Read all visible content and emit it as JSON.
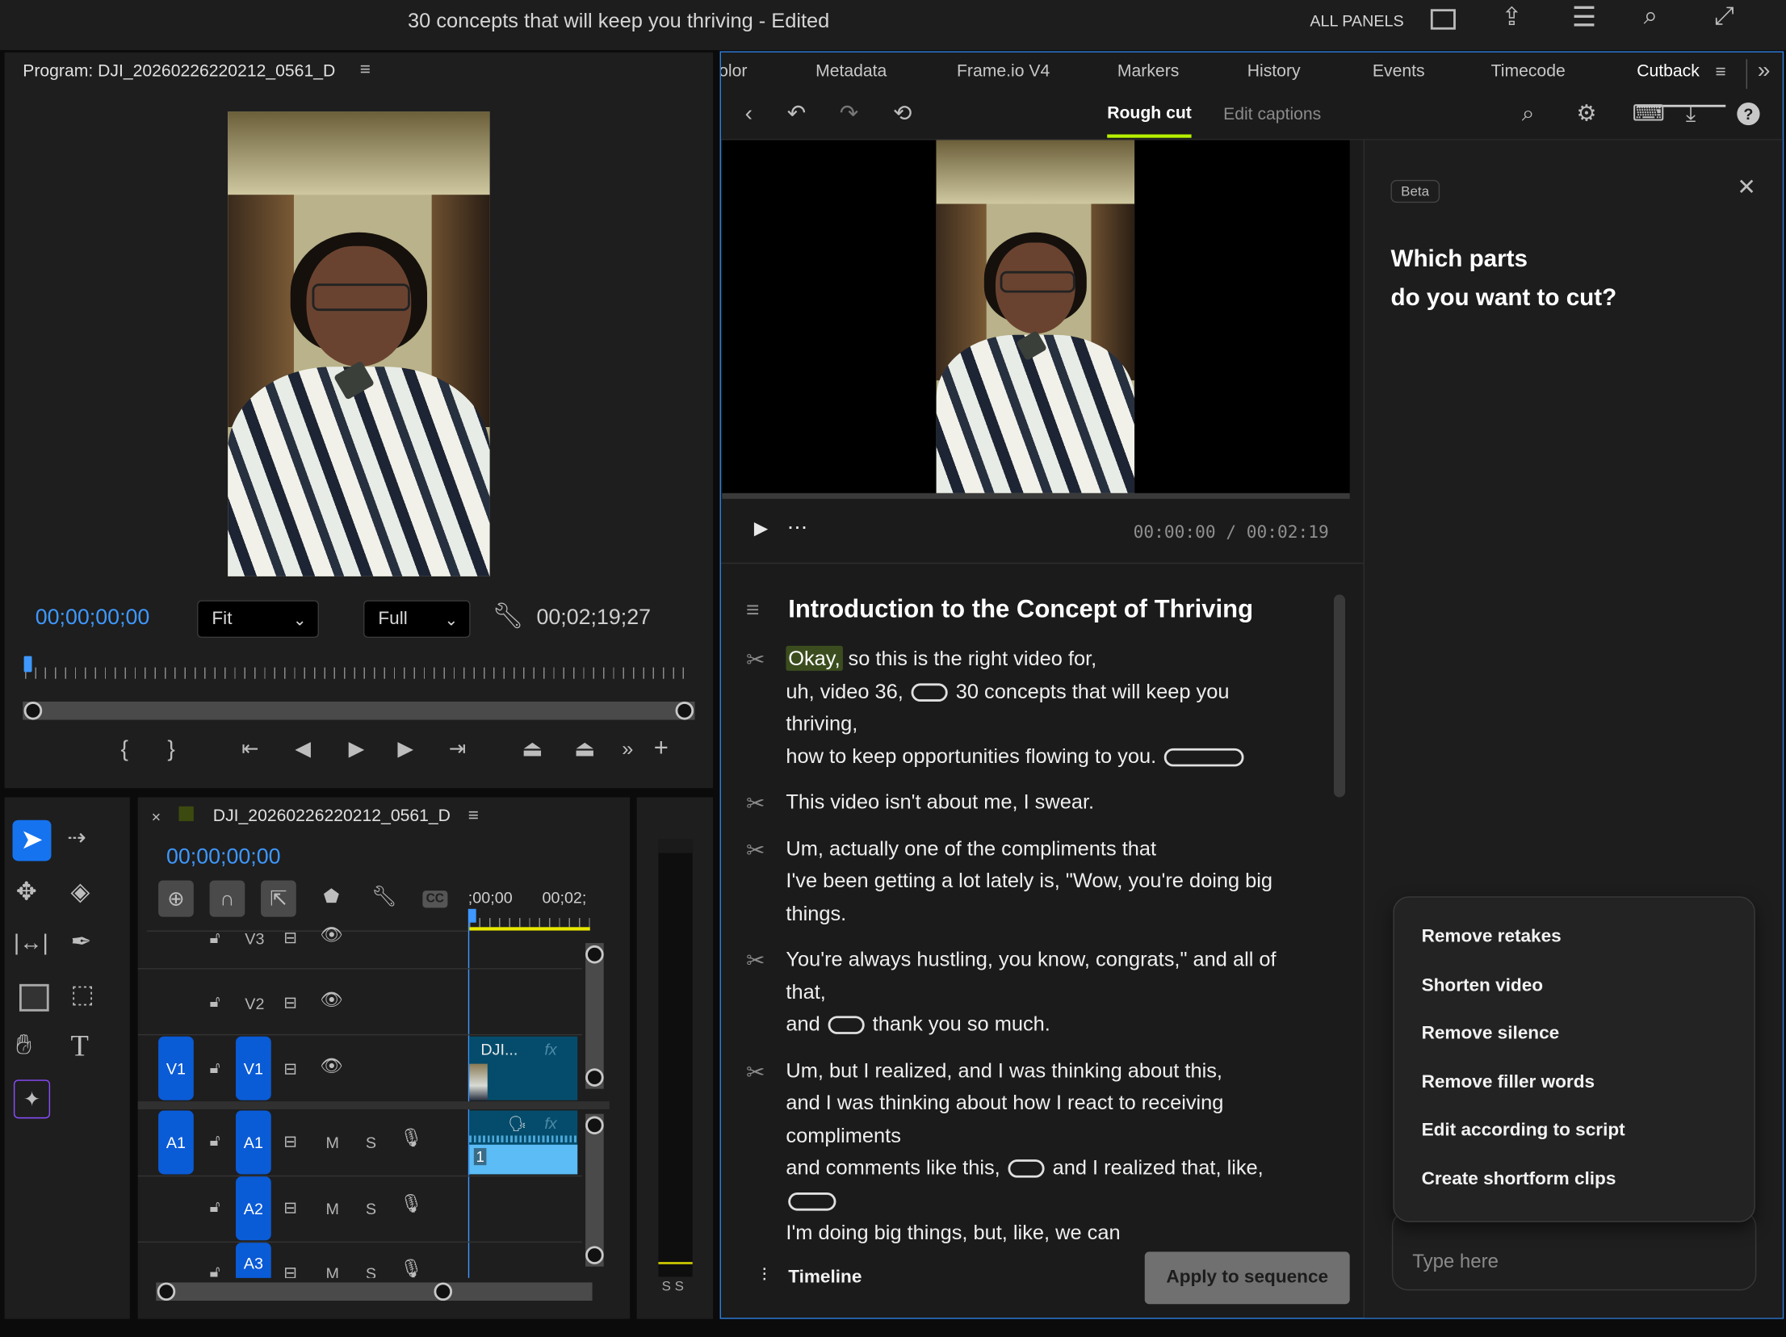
{
  "titlebar": {
    "title": "30 concepts that will keep you thriving - Edited",
    "all_panels": "ALL PANELS",
    "icons": [
      "panel-layout-icon",
      "share-icon",
      "workspaces-icon",
      "search-help-icon",
      "fullscreen-icon"
    ]
  },
  "program_monitor": {
    "title": "Program: DJI_20260226220212_0561_D",
    "current_timecode": "00;00;00;00",
    "zoom_select": "Fit",
    "resolution_select": "Full",
    "duration_timecode": "00;02;19;27",
    "playhead_fraction": 0
  },
  "timeline": {
    "sequence_name": "DJI_20260226220212_0561_D",
    "timecode": "00;00;00;00",
    "ruler_labels": [
      ";00;00",
      "00;02;"
    ],
    "tracks": {
      "v3": "V3",
      "v2": "V2",
      "v1_src": "V1",
      "v1": "V1",
      "a1_src": "A1",
      "a1": "A1",
      "a2": "A2",
      "a3": "A3",
      "mute": "M",
      "solo": "S"
    },
    "video_clip_label": "DJI...",
    "fx_label": "fx",
    "audio_clip_channel": "1",
    "meter_labels": "S S"
  },
  "cutback": {
    "tabs": [
      "olor",
      "Metadata",
      "Frame.io V4",
      "Markers",
      "History",
      "Events",
      "Timecode",
      "Cutback"
    ],
    "active_tab": "Cutback",
    "subtabs": [
      "Rough cut",
      "Edit captions"
    ],
    "active_subtab": "Rough cut",
    "accent_color": "#b6f000",
    "player_time": "00:00:00 / 00:02:19",
    "section_title": "Introduction to the Concept of Thriving",
    "paragraphs": [
      [
        [
          {
            "t": "Okay,",
            "hl": true
          },
          {
            "t": " so this is the right video for,"
          }
        ],
        [
          {
            "t": "uh, video 36, "
          },
          {
            "pill": "short"
          },
          {
            "t": " 30 concepts that will keep you"
          }
        ],
        [
          {
            "t": "thriving,"
          }
        ],
        [
          {
            "t": "how to keep opportunities flowing to you. "
          },
          {
            "pill": "long"
          }
        ]
      ],
      [
        [
          {
            "t": "This video isn't about me, I swear."
          }
        ]
      ],
      [
        [
          {
            "t": "Um, actually one of the compliments that"
          }
        ],
        [
          {
            "t": "I've been getting a lot lately is, \"Wow, you're doing big"
          }
        ],
        [
          {
            "t": "things."
          }
        ]
      ],
      [
        [
          {
            "t": "You're always hustling, you know, congrats,\" and all of"
          }
        ],
        [
          {
            "t": "that,"
          }
        ],
        [
          {
            "t": "and "
          },
          {
            "pill": "short"
          },
          {
            "t": " thank you so much."
          }
        ]
      ],
      [
        [
          {
            "t": "Um, but I realized, and I was thinking about this,"
          }
        ],
        [
          {
            "t": "and I was thinking about how I react to receiving"
          }
        ],
        [
          {
            "t": "compliments"
          }
        ],
        [
          {
            "t": "and comments like this, "
          },
          {
            "pill": "short"
          },
          {
            "t": " and I realized that, like,"
          }
        ],
        [
          {
            "pill": "mid"
          }
        ],
        [
          {
            "t": "I'm doing big things, but, like, we can"
          }
        ]
      ]
    ],
    "timeline_button": "Timeline",
    "apply_button": "Apply to sequence",
    "assistant": {
      "badge": "Beta",
      "heading_line1": "Which parts",
      "heading_line2": "do you want to cut?",
      "suggestions": [
        "Remove retakes",
        "Shorten video",
        "Remove silence",
        "Remove filler words",
        "Edit according to script",
        "Create shortform clips"
      ],
      "input_placeholder": "Type here"
    }
  }
}
